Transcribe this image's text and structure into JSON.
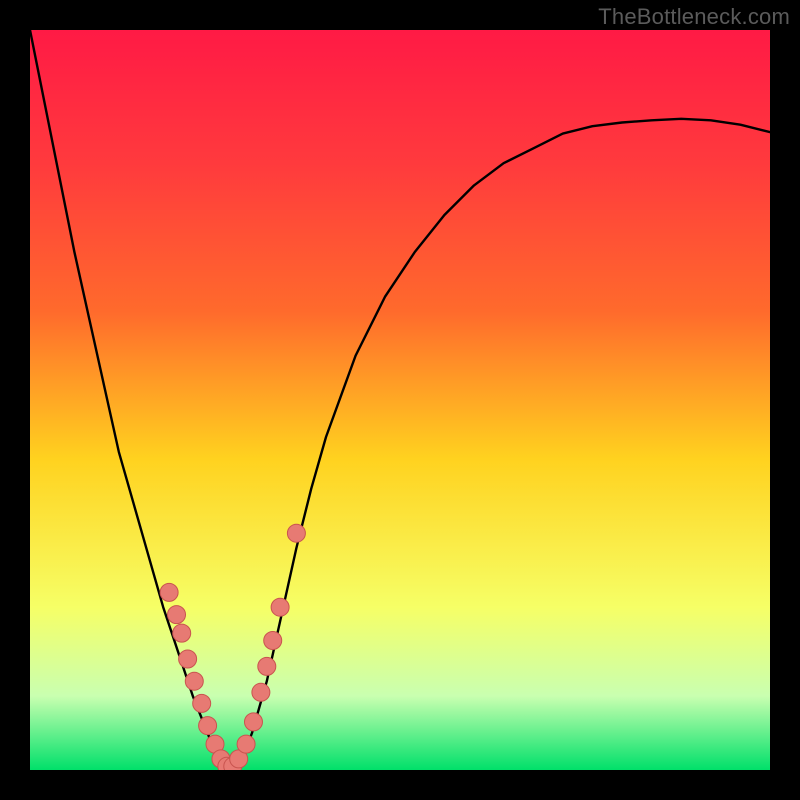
{
  "watermark": "TheBottleneck.com",
  "colors": {
    "frame": "#000000",
    "gradient_top": "#ff1a45",
    "gradient_mid1": "#ff6a2c",
    "gradient_mid2": "#ffd21f",
    "gradient_mid3": "#f6ff66",
    "gradient_low": "#c9ffb0",
    "gradient_bottom": "#00e06a",
    "curve": "#000000",
    "marker_fill": "#e77a73",
    "marker_stroke": "#c9544f"
  },
  "chart_data": {
    "type": "line",
    "title": "",
    "xlabel": "",
    "ylabel": "",
    "x": [
      0.0,
      0.02,
      0.04,
      0.06,
      0.08,
      0.1,
      0.12,
      0.14,
      0.16,
      0.18,
      0.2,
      0.22,
      0.24,
      0.255,
      0.27,
      0.285,
      0.3,
      0.32,
      0.34,
      0.36,
      0.38,
      0.4,
      0.44,
      0.48,
      0.52,
      0.56,
      0.6,
      0.64,
      0.68,
      0.72,
      0.76,
      0.8,
      0.84,
      0.88,
      0.92,
      0.96,
      1.0
    ],
    "y": [
      1.0,
      0.9,
      0.8,
      0.7,
      0.61,
      0.52,
      0.43,
      0.36,
      0.29,
      0.22,
      0.16,
      0.1,
      0.05,
      0.01,
      0.0,
      0.01,
      0.05,
      0.12,
      0.21,
      0.3,
      0.38,
      0.45,
      0.56,
      0.64,
      0.7,
      0.75,
      0.79,
      0.82,
      0.84,
      0.86,
      0.87,
      0.875,
      0.878,
      0.88,
      0.878,
      0.872,
      0.862
    ],
    "xlim": [
      0,
      1
    ],
    "ylim": [
      0,
      1
    ],
    "markers": {
      "x": [
        0.188,
        0.198,
        0.205,
        0.213,
        0.222,
        0.232,
        0.24,
        0.25,
        0.258,
        0.266,
        0.274,
        0.282,
        0.292,
        0.302,
        0.312,
        0.32,
        0.328,
        0.338,
        0.36
      ],
      "y": [
        0.24,
        0.21,
        0.185,
        0.15,
        0.12,
        0.09,
        0.06,
        0.035,
        0.015,
        0.005,
        0.005,
        0.015,
        0.035,
        0.065,
        0.105,
        0.14,
        0.175,
        0.22,
        0.32
      ]
    }
  }
}
